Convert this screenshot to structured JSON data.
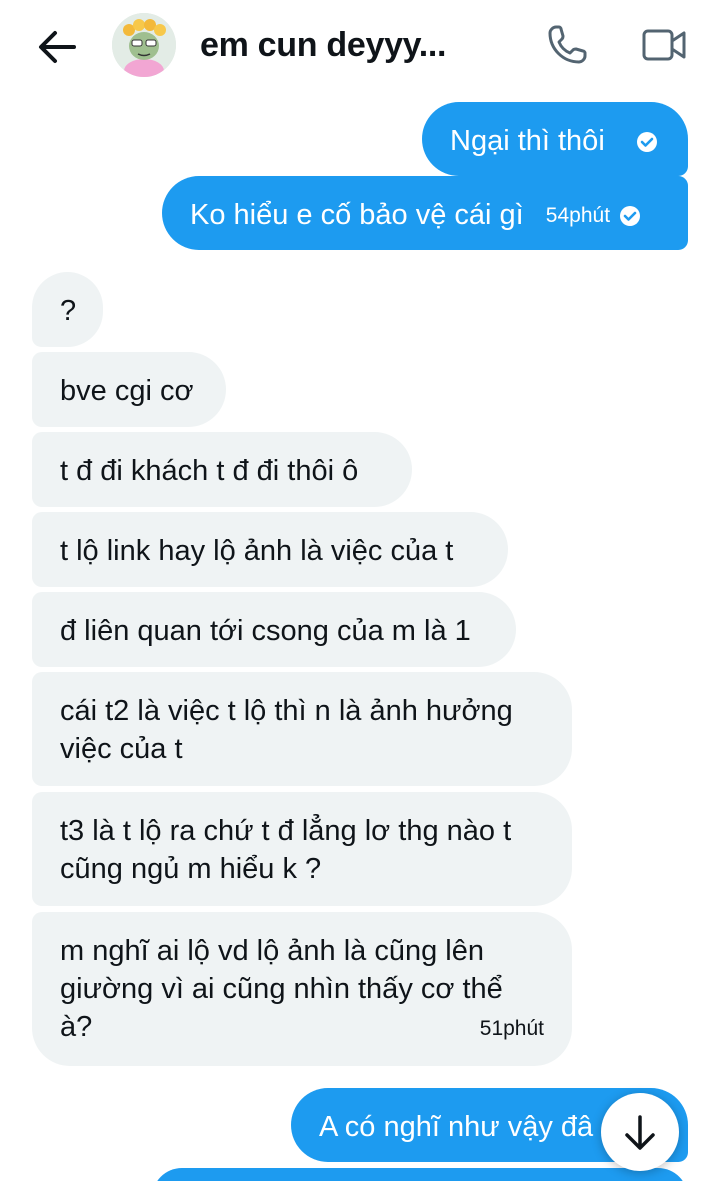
{
  "header": {
    "contact_name": "em cun deyyy...",
    "back_icon": "arrow-left-icon",
    "phone_icon": "phone-icon",
    "video_icon": "video-camera-icon"
  },
  "messages": [
    {
      "direction": "sent",
      "text": "Ngại thì thôi",
      "time": "",
      "status_icon": "check-circle-icon"
    },
    {
      "direction": "sent",
      "text": "Ko hiểu e cố bảo vệ cái gì",
      "time": "54phút",
      "status_icon": "check-circle-icon"
    },
    {
      "direction": "received",
      "text": "?"
    },
    {
      "direction": "received",
      "text": "bve cgi cơ"
    },
    {
      "direction": "received",
      "text": "t đ đi khách t đ đi thôi ô"
    },
    {
      "direction": "received",
      "text": "t lộ link hay lộ ảnh là việc của t"
    },
    {
      "direction": "received",
      "text": "đ liên quan tới csong của m là 1"
    },
    {
      "direction": "received",
      "text_lines": [
        "cái t2 là việc t lộ thì n là ảnh hưởng",
        "việc của t"
      ]
    },
    {
      "direction": "received",
      "text_lines": [
        "t3 là t lộ ra chứ t đ lẳng lơ thg nào t",
        "cũng ngủ m hiểu k ?"
      ]
    },
    {
      "direction": "received",
      "text_lines": [
        "m nghĩ ai lộ vd lộ ảnh là cũng lên",
        "giường vì ai cũng nhìn thấy cơ thể",
        "à?"
      ],
      "time": "51phút"
    },
    {
      "direction": "sent",
      "text": "A có nghĩ như vậy đâ"
    }
  ],
  "scroll_button_icon": "arrow-down-icon",
  "colors": {
    "sent_bubble": "#1d9bf0",
    "received_bubble": "#eff3f4",
    "text": "#0f1419"
  }
}
